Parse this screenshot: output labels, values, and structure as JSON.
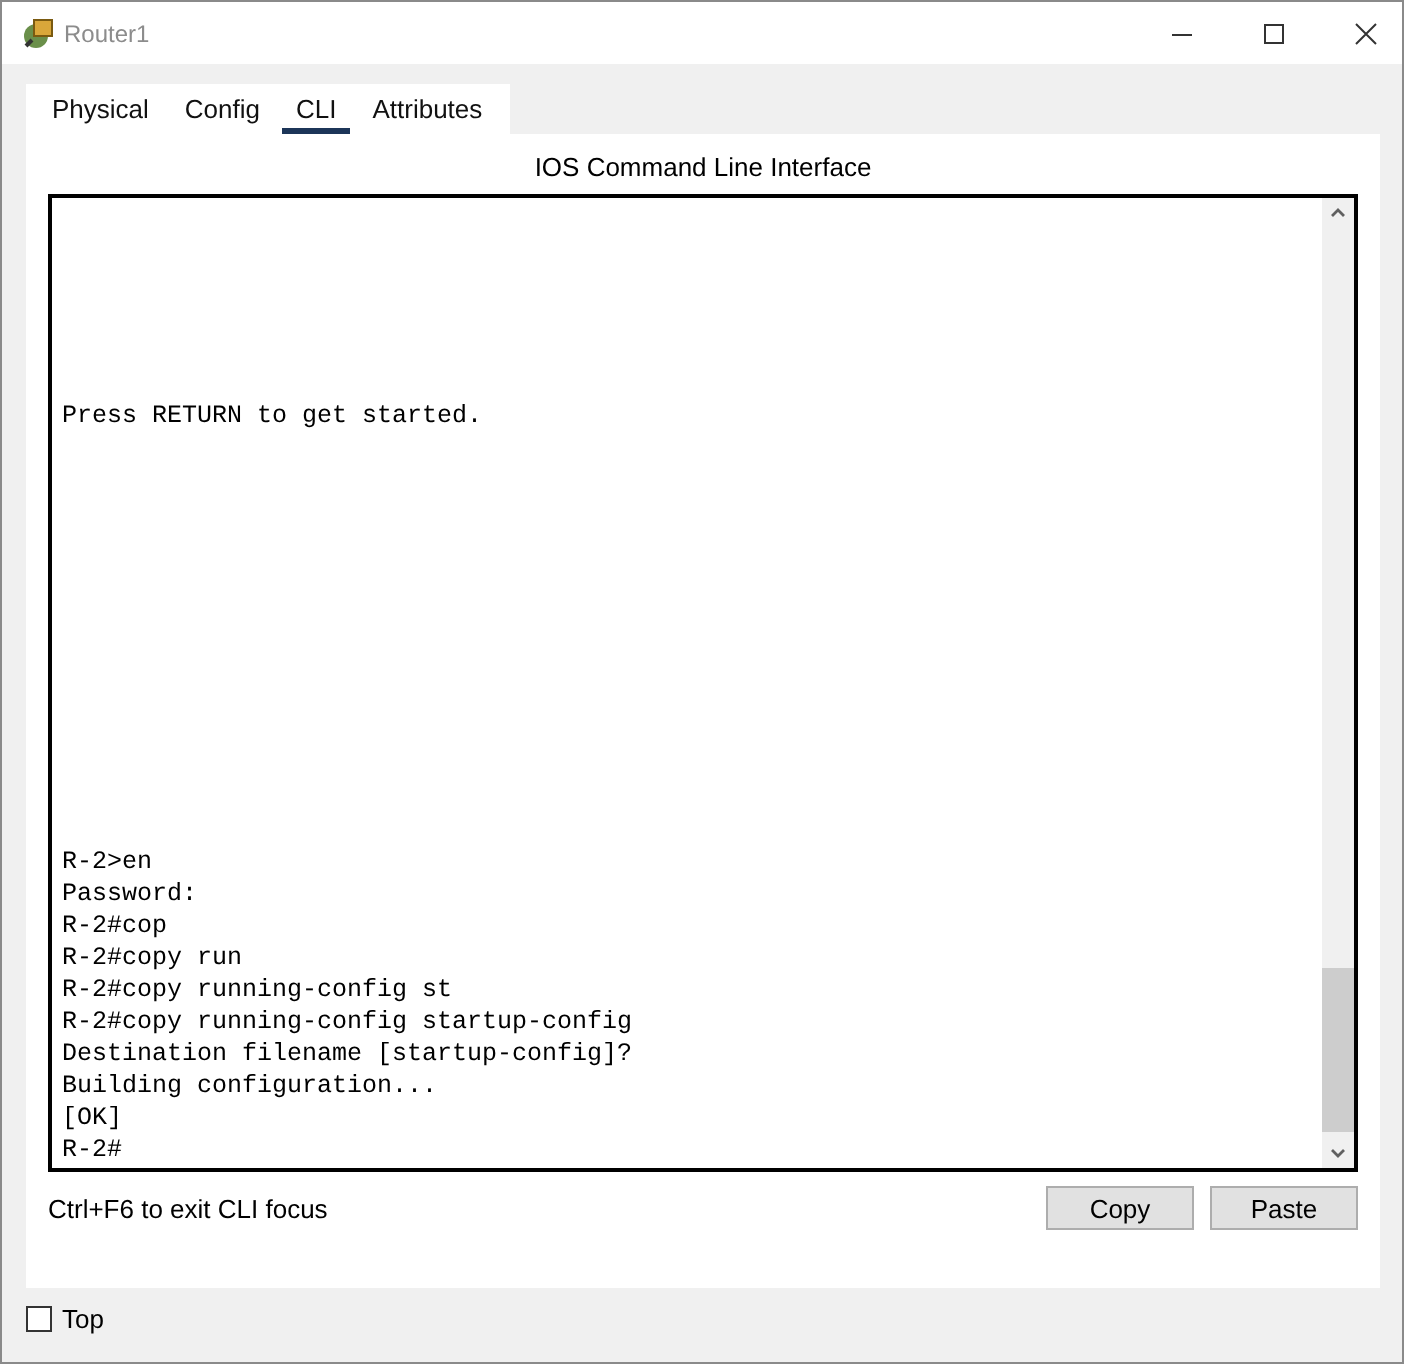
{
  "window": {
    "title": "Router1"
  },
  "tabs": [
    {
      "label": "Physical",
      "selected": false
    },
    {
      "label": "Config",
      "selected": false
    },
    {
      "label": "CLI",
      "selected": true
    },
    {
      "label": "Attributes",
      "selected": false
    }
  ],
  "cli": {
    "heading": "IOS Command Line Interface",
    "top_lines": [
      "Press RETURN to get started."
    ],
    "bottom_lines": [
      "R-2>en",
      "Password:",
      "R-2#cop",
      "R-2#copy run",
      "R-2#copy running-config st",
      "R-2#copy running-config startup-config",
      "Destination filename [startup-config]?",
      "Building configuration...",
      "[OK]",
      "R-2#"
    ],
    "hint": "Ctrl+F6 to exit CLI focus",
    "buttons": [
      "Copy",
      "Paste"
    ]
  },
  "top_checkbox": {
    "label": "Top",
    "checked": false
  }
}
